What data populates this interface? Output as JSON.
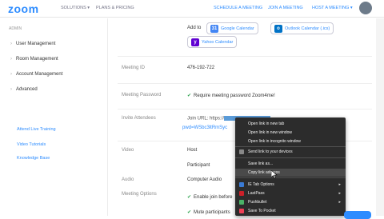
{
  "header": {
    "logo": "zoom",
    "nav": [
      "SOLUTIONS ▾",
      "PLANS & PRICING"
    ],
    "right_nav": [
      "SCHEDULE A MEETING",
      "JOIN A MEETING",
      "HOST A MEETING ▾"
    ]
  },
  "sidebar": {
    "section": "ADMIN",
    "items": [
      "User Management",
      "Room Management",
      "Account Management",
      "Advanced"
    ],
    "links": [
      "Attend Live Training",
      "Video Tutorials",
      "Knowledge Base"
    ]
  },
  "main": {
    "add_to": "Add to",
    "calendars": [
      "Google Calendar",
      "Outlook Calendar (.ics)",
      "Yahoo Calendar"
    ],
    "meeting_id_label": "Meeting ID",
    "meeting_id": "476-192-722",
    "password_label": "Meeting Password",
    "password_value": "Require meeting password   Zoom4me!",
    "invite_label": "Invite Attendees",
    "join_url_prefix": "Join URL: https://",
    "join_url_line2": "pwd=WSbc3ltRmSyc",
    "video_label": "Video",
    "video_host": "Host",
    "video_participant": "Participant",
    "audio_label": "Audio",
    "audio_value": "Computer Audio",
    "options_label": "Meeting Options",
    "option1": "Enable join before",
    "option2": "Mute participants"
  },
  "context_menu": {
    "items": [
      "Open link in new tab",
      "Open link in new window",
      "Open link in incognito window",
      "Send link to your devices",
      "Save link as...",
      "Copy link address",
      "IE Tab Options",
      "LastPass",
      "Pushbullet",
      "Save To Pocket"
    ]
  },
  "colors": {
    "accent": "#2D8CFF",
    "menu_bg": "#2c2c2c"
  }
}
